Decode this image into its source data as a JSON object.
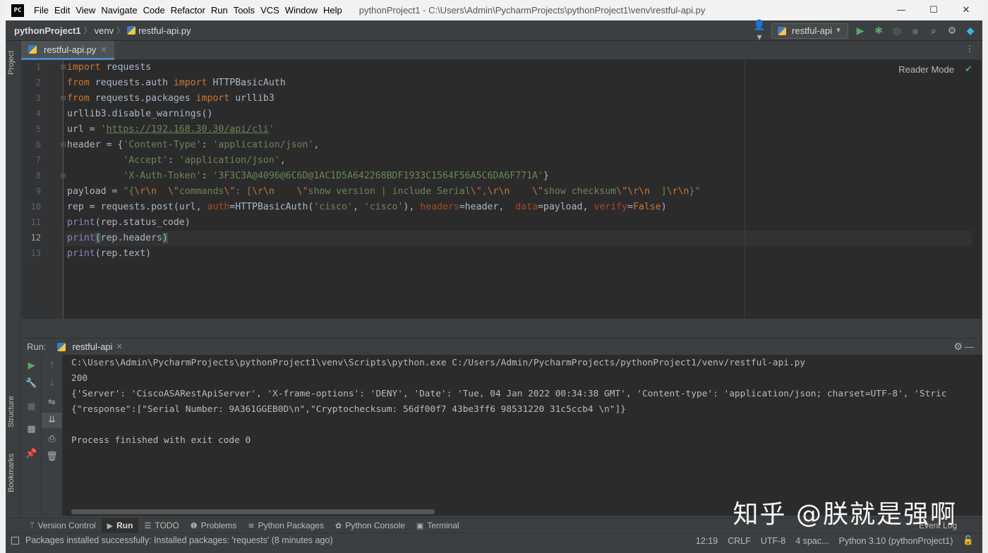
{
  "titlebar": {
    "logo": "PC",
    "menu": [
      "File",
      "Edit",
      "View",
      "Navigate",
      "Code",
      "Refactor",
      "Run",
      "Tools",
      "VCS",
      "Window",
      "Help"
    ],
    "title": "pythonProject1 - C:\\Users\\Admin\\PycharmProjects\\pythonProject1\\venv\\restful-api.py",
    "controls": [
      "—",
      "☐",
      "✕"
    ]
  },
  "navbar": {
    "breadcrumbs": [
      "pythonProject1",
      "venv",
      "restful-api.py"
    ],
    "run_config": "restful-api"
  },
  "left_stripe": {
    "project": "Project",
    "structure": "Structure",
    "bookmarks": "Bookmarks"
  },
  "editor": {
    "tab": "restful-api.py",
    "reader_mode": "Reader Mode",
    "line_numbers": [
      "1",
      "2",
      "3",
      "4",
      "5",
      "6",
      "7",
      "8",
      "9",
      "10",
      "11",
      "12",
      "13"
    ],
    "current_line": 12
  },
  "run_panel": {
    "label": "Run:",
    "tab": "restful-api",
    "output": [
      "C:\\Users\\Admin\\PycharmProjects\\pythonProject1\\venv\\Scripts\\python.exe C:/Users/Admin/PycharmProjects/pythonProject1/venv/restful-api.py",
      "200",
      "{'Server': 'CiscoASARestApiServer', 'X-frame-options': 'DENY', 'Date': 'Tue, 04 Jan 2022 00:34:38 GMT', 'Content-type': 'application/json; charset=UTF-8', 'Stric",
      "{\"response\":[\"Serial Number: 9A361GGEB0D\\n\",\"Cryptochecksum: 56df00f7 43be3ff6 98531220 31c5ccb4 \\n\"]}",
      "",
      "Process finished with exit code 0"
    ]
  },
  "tool_windows": [
    "Version Control",
    "Run",
    "TODO",
    "Problems",
    "Python Packages",
    "Python Console",
    "Terminal"
  ],
  "event_log": "Event Log",
  "status": {
    "message": "Packages installed successfully: Installed packages: 'requests' (8 minutes ago)",
    "position": "12:19",
    "line_sep": "CRLF",
    "encoding": "UTF-8",
    "indent": "4 spac...",
    "interpreter": "Python 3.10 (pythonProject1)"
  },
  "watermark": "知乎 @朕就是强啊",
  "colors": {
    "keyword": "#cc7832",
    "string": "#6a8759",
    "builtin": "#8888c6",
    "param": "#aa4926",
    "accent": "#4a88c7",
    "run_green": "#59a869"
  }
}
